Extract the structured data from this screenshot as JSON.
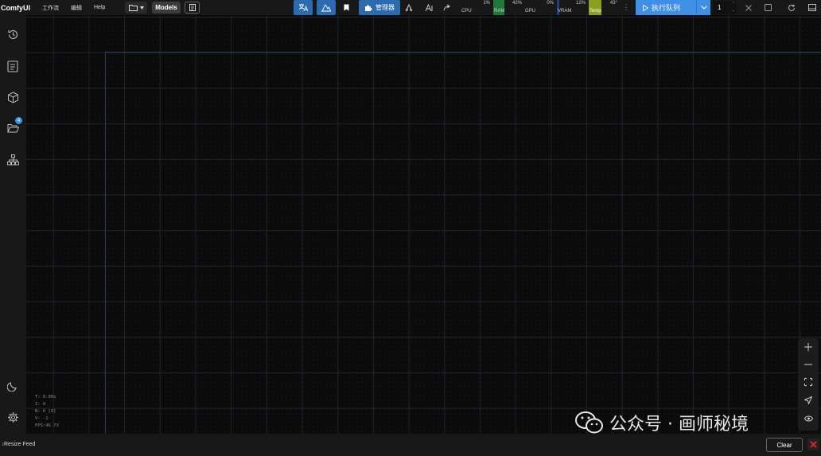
{
  "app": {
    "name": "ComfyUI"
  },
  "menu": {
    "items": [
      "工作流",
      "编辑",
      "Help"
    ]
  },
  "toolbar": {
    "models_label": "Models",
    "manager_label": "管理器",
    "run_label": "执行队列",
    "queue_count": "1"
  },
  "stats": {
    "cpu": {
      "label": "CPU",
      "pct": "1%"
    },
    "ram": {
      "label": "RAM",
      "pct": "42%"
    },
    "gpu": {
      "label": "GPU",
      "pct": "0%"
    },
    "vram": {
      "label": "VRAM",
      "pct": "12%"
    },
    "temp": {
      "label": "Temp",
      "pct": "43°"
    }
  },
  "sidebar": {
    "folder_badge": "4"
  },
  "canvas": {
    "overlay": [
      "T: 0.00s",
      "I: 0",
      "N: 0 [0]",
      "V: -1",
      "FPS:46.73"
    ]
  },
  "watermark": {
    "text": "公众号 · 画师秘境"
  },
  "bottom": {
    "resize_feed": "Resize Feed",
    "clear_label": "Clear"
  },
  "colors": {
    "accent": "#3f8fe6",
    "manager": "#2d6bb0",
    "ram_bar": "#1f7a3a",
    "vram_bar": "#1f3f8a",
    "temp_bar": "#8aa020",
    "close": "#e02020"
  }
}
